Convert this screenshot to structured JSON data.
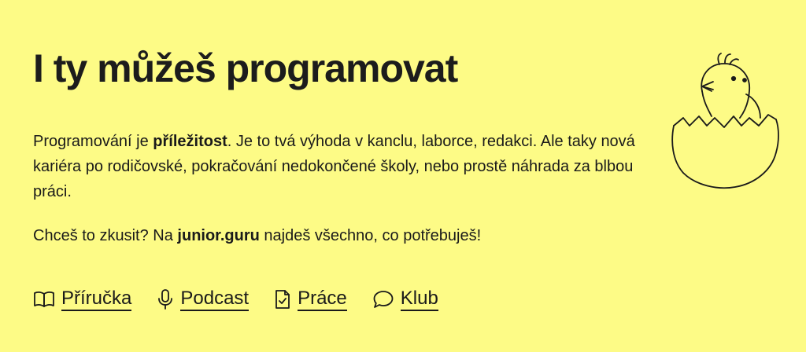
{
  "hero": {
    "title": "I ty můžeš programovat",
    "intro": {
      "part1": "Programování je ",
      "strong1": "příležitost",
      "part2": ". Je to tvá výhoda v kanclu, laborce, redakci. Ale taky nová kariéra po rodičovské, pokračování nedokončené školy, nebo prostě náhrada za blbou práci."
    },
    "cta": {
      "part1": "Chceš to zkusit? Na ",
      "strong": "junior.guru",
      "part2": " najdeš všechno, co potřebuješ!"
    }
  },
  "nav": [
    {
      "label": "Příručka",
      "icon": "book-icon"
    },
    {
      "label": "Podcast",
      "icon": "microphone-icon"
    },
    {
      "label": "Práce",
      "icon": "document-check-icon"
    },
    {
      "label": "Klub",
      "icon": "chat-bubble-icon"
    }
  ]
}
